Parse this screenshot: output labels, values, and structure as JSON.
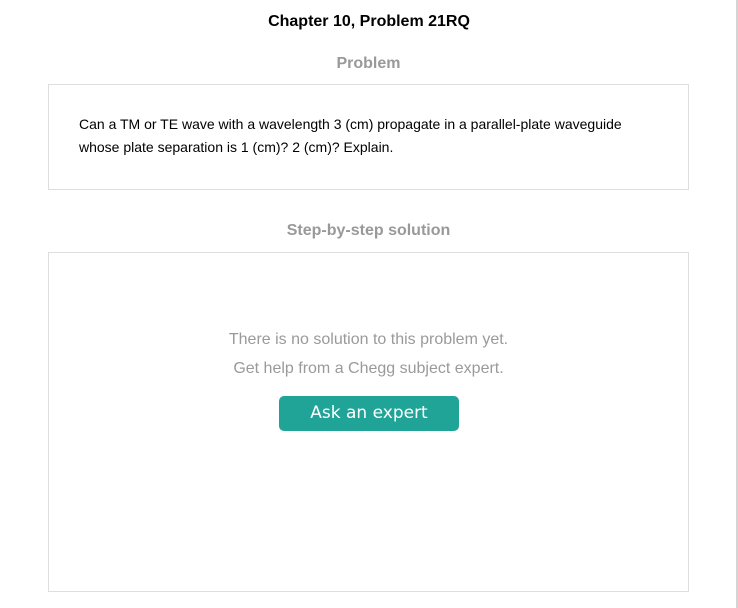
{
  "page": {
    "title": "Chapter 10, Problem 21RQ"
  },
  "problem": {
    "heading": "Problem",
    "text": "Can a TM or TE wave with a wavelength 3 (cm) propagate in a parallel-plate waveguide whose plate separation is 1 (cm)? 2 (cm)? Explain."
  },
  "solution": {
    "heading": "Step-by-step solution",
    "empty_message_line1": "There is no solution to this problem yet.",
    "empty_message_line2": "Get help from a Chegg subject expert.",
    "button_label": "Ask an expert"
  },
  "colors": {
    "button": "#21a498",
    "heading_gray": "#999999",
    "border": "#dedede"
  }
}
